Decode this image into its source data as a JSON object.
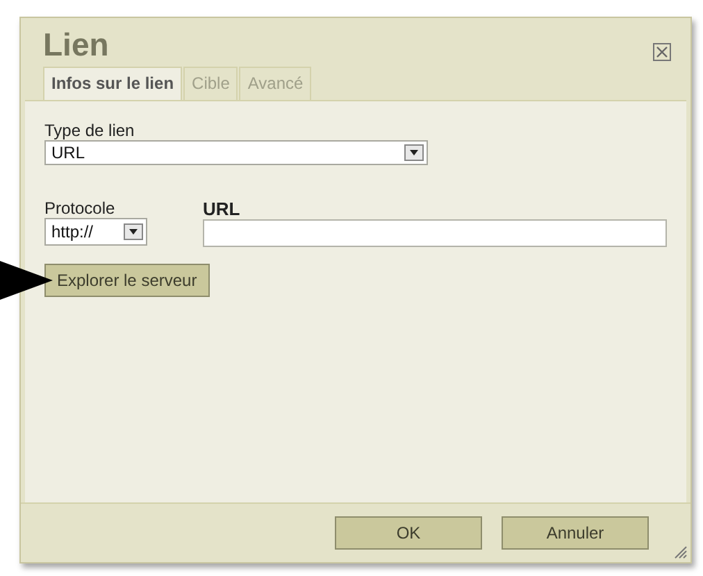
{
  "dialog": {
    "title": "Lien"
  },
  "tabs": [
    {
      "label": "Infos sur le lien",
      "selected": true
    },
    {
      "label": "Cible",
      "selected": false
    },
    {
      "label": "Avancé",
      "selected": false
    }
  ],
  "link_type": {
    "label": "Type de lien",
    "value": "URL"
  },
  "protocol": {
    "label": "Protocole",
    "value": "http://"
  },
  "url": {
    "label": "URL"
  },
  "browse_button": "Explorer le serveur",
  "buttons": [
    "OK",
    "Annuler"
  ]
}
